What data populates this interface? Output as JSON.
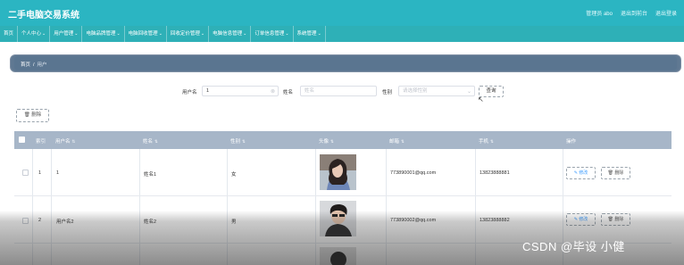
{
  "app": {
    "title": "二手电脑交易系统"
  },
  "header": {
    "links": [
      "管理员 abo",
      "退出到前台",
      "退出登录"
    ]
  },
  "nav": {
    "items": [
      {
        "label": "首页",
        "has_menu": false
      },
      {
        "label": "个人中心",
        "has_menu": true
      },
      {
        "label": "用户管理",
        "has_menu": true
      },
      {
        "label": "电脑品牌管理",
        "has_menu": true
      },
      {
        "label": "电脑回收管理",
        "has_menu": true
      },
      {
        "label": "回收定价管理",
        "has_menu": true
      },
      {
        "label": "电脑信息管理",
        "has_menu": true
      },
      {
        "label": "订单信息管理",
        "has_menu": true
      },
      {
        "label": "系统管理",
        "has_menu": true
      }
    ]
  },
  "breadcrumb": {
    "home": "首页",
    "separator": "/",
    "current": "用户"
  },
  "search": {
    "username_label": "用户名",
    "username_value": "1",
    "name_label": "姓名",
    "name_placeholder": "姓名",
    "gender_label": "性别",
    "gender_placeholder": "请选择性别",
    "button": "查询"
  },
  "actions": {
    "delete_label": "删除"
  },
  "table": {
    "columns": [
      "索引",
      "用户名",
      "姓名",
      "性别",
      "头像",
      "邮箱",
      "手机",
      "操作"
    ],
    "rows": [
      {
        "index": "1",
        "username": "1",
        "name": "姓名1",
        "gender": "女",
        "email": "773890001@qq.com",
        "phone": "13823888881"
      },
      {
        "index": "2",
        "username": "用户名2",
        "name": "姓名2",
        "gender": "男",
        "email": "773890002@qq.com",
        "phone": "13823888882"
      }
    ],
    "edit_label": "修改",
    "delete_label": "删除"
  },
  "watermark": "CSDN @毕设 小健",
  "colors": {
    "header": "#2bb5c2",
    "nav": "#2eb0b7",
    "breadcrumb": "#5a7590",
    "table_head": "#a7b6c8",
    "edit": "#409eff"
  }
}
